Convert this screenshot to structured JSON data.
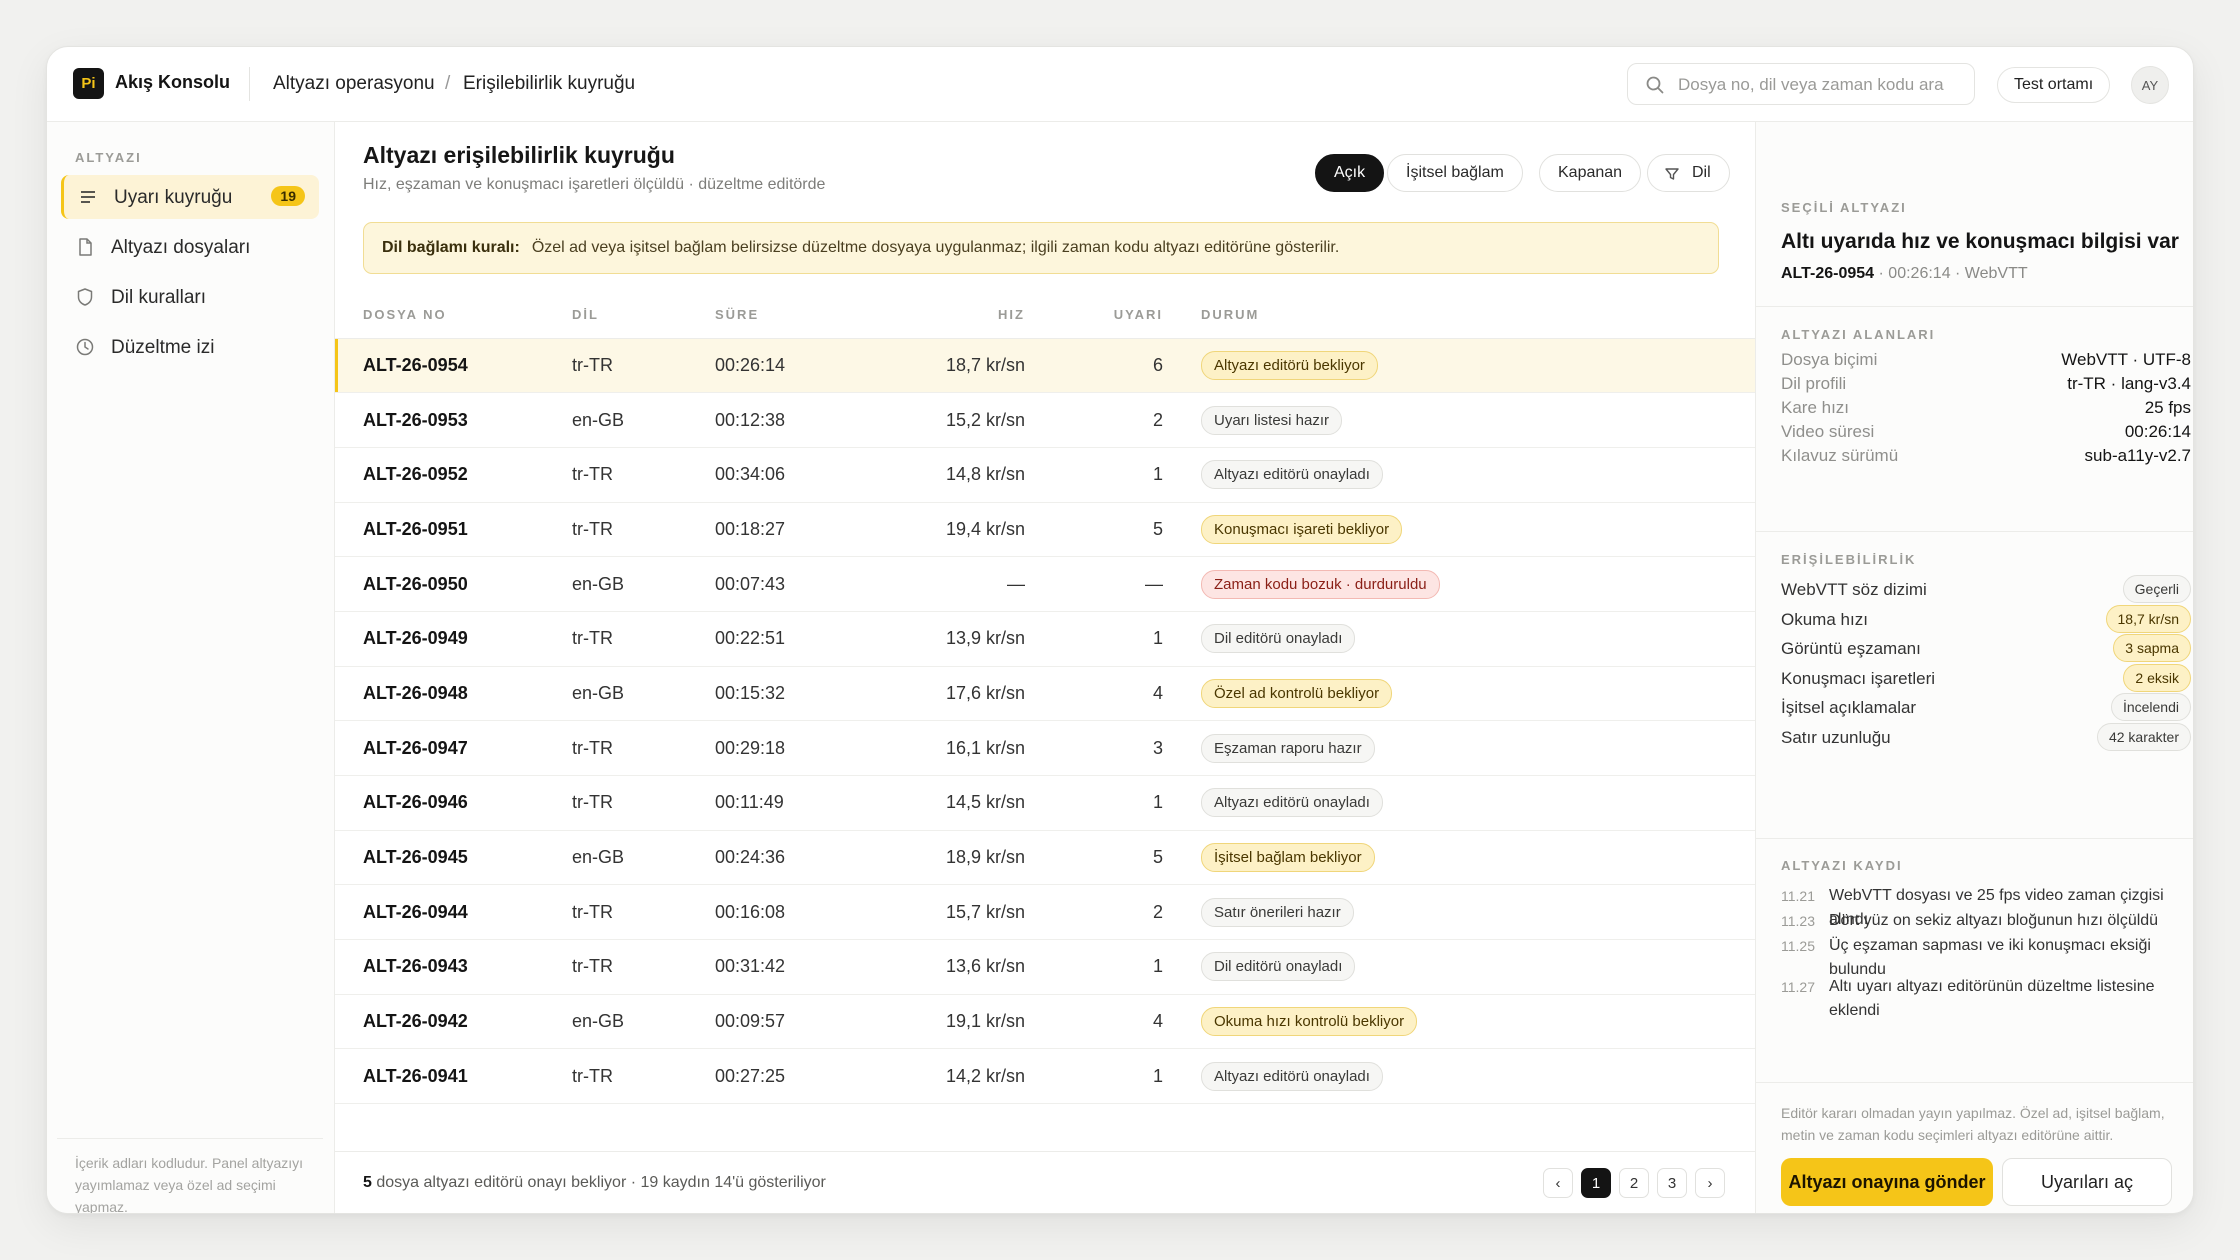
{
  "app": {
    "logo": "Pi",
    "name": "Akış Konsolu"
  },
  "breadcrumb": [
    "Altyazı operasyonu",
    "Erişilebilirlik kuyruğu"
  ],
  "breadcrumb_sep": "/",
  "search": {
    "placeholder": "Dosya no, dil veya zaman kodu ara",
    "icon": "search-icon"
  },
  "env_button": "Test ortamı",
  "avatar": "AY",
  "sidebar": {
    "section": "ALTYAZI",
    "items": [
      {
        "label": "Uyarı kuyruğu",
        "badge": "19",
        "icon": "list-icon",
        "active": true
      },
      {
        "label": "Altyazı dosyaları",
        "icon": "file-icon"
      },
      {
        "label": "Dil kuralları",
        "icon": "shield-icon"
      },
      {
        "label": "Düzeltme izi",
        "icon": "clock-icon"
      }
    ],
    "note": "İçerik adları kodludur. Panel altyazıyı yayımlamaz veya özel ad seçimi yapmaz."
  },
  "main": {
    "title": "Altyazı erişilebilirlik kuyruğu",
    "subtitle": "Hız, eşzaman ve konuşmacı işaretleri ölçüldü · düzeltme editörde",
    "filters": [
      "Açık",
      "İşitsel bağlam",
      "Kapanan"
    ],
    "filter_lang": "Dil",
    "rule_label": "Dil bağlamı kuralı:",
    "rule_text": "Özel ad veya işitsel bağlam belirsizse düzeltme dosyaya uygulanmaz; ilgili zaman kodu altyazı editörüne gösterilir.",
    "columns": [
      "DOSYA NO",
      "DİL",
      "SÜRE",
      "HIZ",
      "UYARI",
      "DURUM"
    ],
    "rows": [
      {
        "id": "ALT-26-0954",
        "lang": "tr-TR",
        "dur": "00:26:14",
        "speed": "18,7 kr/sn",
        "warn": "6",
        "status": "Altyazı editörü bekliyor",
        "tone": "warn"
      },
      {
        "id": "ALT-26-0953",
        "lang": "en-GB",
        "dur": "00:12:38",
        "speed": "15,2 kr/sn",
        "warn": "2",
        "status": "Uyarı listesi hazır",
        "tone": "neutral"
      },
      {
        "id": "ALT-26-0952",
        "lang": "tr-TR",
        "dur": "00:34:06",
        "speed": "14,8 kr/sn",
        "warn": "1",
        "status": "Altyazı editörü onayladı",
        "tone": "neutral"
      },
      {
        "id": "ALT-26-0951",
        "lang": "tr-TR",
        "dur": "00:18:27",
        "speed": "19,4 kr/sn",
        "warn": "5",
        "status": "Konuşmacı işareti bekliyor",
        "tone": "warn"
      },
      {
        "id": "ALT-26-0950",
        "lang": "en-GB",
        "dur": "00:07:43",
        "speed": "—",
        "warn": "—",
        "status": "Zaman kodu bozuk · durduruldu",
        "tone": "err"
      },
      {
        "id": "ALT-26-0949",
        "lang": "tr-TR",
        "dur": "00:22:51",
        "speed": "13,9 kr/sn",
        "warn": "1",
        "status": "Dil editörü onayladı",
        "tone": "neutral"
      },
      {
        "id": "ALT-26-0948",
        "lang": "en-GB",
        "dur": "00:15:32",
        "speed": "17,6 kr/sn",
        "warn": "4",
        "status": "Özel ad kontrolü bekliyor",
        "tone": "warn"
      },
      {
        "id": "ALT-26-0947",
        "lang": "tr-TR",
        "dur": "00:29:18",
        "speed": "16,1 kr/sn",
        "warn": "3",
        "status": "Eşzaman raporu hazır",
        "tone": "neutral"
      },
      {
        "id": "ALT-26-0946",
        "lang": "tr-TR",
        "dur": "00:11:49",
        "speed": "14,5 kr/sn",
        "warn": "1",
        "status": "Altyazı editörü onayladı",
        "tone": "neutral"
      },
      {
        "id": "ALT-26-0945",
        "lang": "en-GB",
        "dur": "00:24:36",
        "speed": "18,9 kr/sn",
        "warn": "5",
        "status": "İşitsel bağlam bekliyor",
        "tone": "warn"
      },
      {
        "id": "ALT-26-0944",
        "lang": "tr-TR",
        "dur": "00:16:08",
        "speed": "15,7 kr/sn",
        "warn": "2",
        "status": "Satır önerileri hazır",
        "tone": "neutral"
      },
      {
        "id": "ALT-26-0943",
        "lang": "tr-TR",
        "dur": "00:31:42",
        "speed": "13,6 kr/sn",
        "warn": "1",
        "status": "Dil editörü onayladı",
        "tone": "neutral"
      },
      {
        "id": "ALT-26-0942",
        "lang": "en-GB",
        "dur": "00:09:57",
        "speed": "19,1 kr/sn",
        "warn": "4",
        "status": "Okuma hızı kontrolü bekliyor",
        "tone": "warn"
      },
      {
        "id": "ALT-26-0941",
        "lang": "tr-TR",
        "dur": "00:27:25",
        "speed": "14,2 kr/sn",
        "warn": "1",
        "status": "Altyazı editörü onayladı",
        "tone": "neutral"
      }
    ],
    "footer_count": "5",
    "footer_text": " dosya altyazı editörü onayı bekliyor · 19 kaydın 14'ü gösteriliyor",
    "pages": [
      "‹",
      "1",
      "2",
      "3",
      "›"
    ]
  },
  "panel": {
    "section_selected": "SEÇİLİ ALTYAZI",
    "title": "Altı uyarıda hız ve konuşmacı bilgisi var",
    "sel_id": "ALT-26-0954",
    "sel_meta": "· 00:26:14 · WebVTT",
    "section_fields": "ALTYAZI ALANLARI",
    "fields": [
      {
        "k": "Dosya biçimi",
        "v": "WebVTT · UTF-8"
      },
      {
        "k": "Dil profili",
        "v": "tr-TR · lang-v3.4"
      },
      {
        "k": "Kare hızı",
        "v": "25 fps"
      },
      {
        "k": "Video süresi",
        "v": "00:26:14"
      },
      {
        "k": "Kılavuz sürümü",
        "v": "sub-a11y-v2.7"
      }
    ],
    "section_access": "ERİŞİLEBİLİRLİK",
    "access": [
      {
        "k": "WebVTT söz dizimi",
        "v": "Geçerli",
        "tone": "neutral"
      },
      {
        "k": "Okuma hızı",
        "v": "18,7 kr/sn",
        "tone": "warn"
      },
      {
        "k": "Görüntü eşzamanı",
        "v": "3 sapma",
        "tone": "warn"
      },
      {
        "k": "Konuşmacı işaretleri",
        "v": "2 eksik",
        "tone": "warn"
      },
      {
        "k": "İşitsel açıklamalar",
        "v": "İncelendi",
        "tone": "neutral"
      },
      {
        "k": "Satır uzunluğu",
        "v": "42 karakter",
        "tone": "neutral"
      }
    ],
    "section_log": "ALTYAZI KAYDI",
    "log": [
      {
        "t": "11.21",
        "m": "WebVTT dosyası ve 25 fps video zaman çizgisi alındı"
      },
      {
        "t": "11.23",
        "m": "Dört yüz on sekiz altyazı bloğunun hızı ölçüldü"
      },
      {
        "t": "11.25",
        "m": "Üç eşzaman sapması ve iki konuşmacı eksiği bulundu"
      },
      {
        "t": "11.27",
        "m": "Altı uyarı altyazı editörünün düzeltme listesine eklendi"
      }
    ],
    "note": "Editör kararı olmadan yayın yapılmaz. Özel ad, işitsel bağlam, metin ve zaman kodu seçimleri altyazı editörüne aittir.",
    "primary_button": "Altyazı onayına gönder",
    "secondary_button": "Uyarıları aç"
  },
  "colors": {
    "accent": "#f5c518",
    "dark": "#141414",
    "error": "#8a1f16"
  }
}
